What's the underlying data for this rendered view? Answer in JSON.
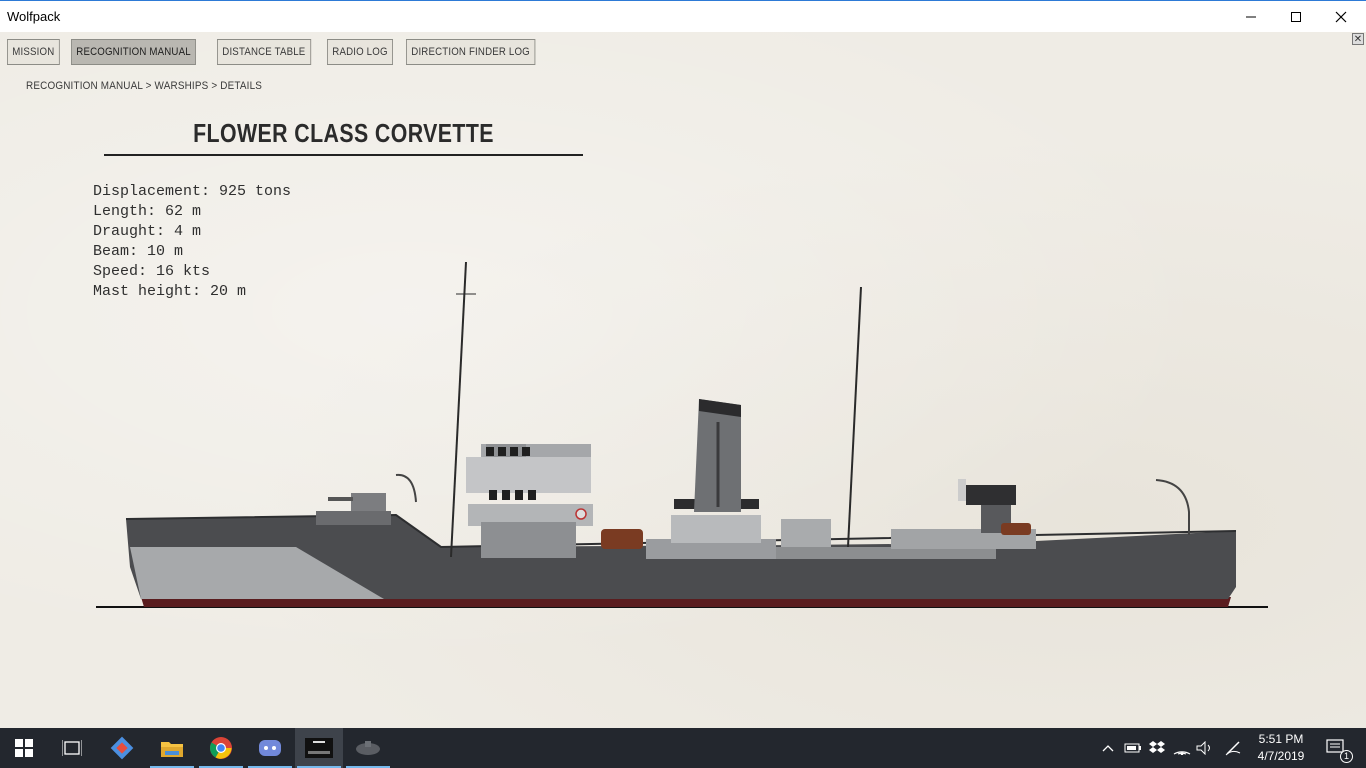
{
  "window": {
    "title": "Wolfpack"
  },
  "tabs": [
    {
      "label": "MISSION",
      "active": false
    },
    {
      "label": "RECOGNITION MANUAL",
      "active": true
    },
    {
      "label": "DISTANCE TABLE",
      "active": false
    },
    {
      "label": "RADIO LOG",
      "active": false
    },
    {
      "label": "DIRECTION FINDER LOG",
      "active": false
    }
  ],
  "breadcrumb": "RECOGNITION MANUAL > WARSHIPS > DETAILS",
  "ship": {
    "name": "FLOWER CLASS CORVETTE",
    "specs": [
      "Displacement: 925 tons",
      "Length: 62 m",
      "Draught: 4 m",
      "Beam: 10 m",
      "Speed: 16 kts",
      "Mast height: 20 m"
    ]
  },
  "taskbar": {
    "apps": [
      "windows-start-icon",
      "task-view-icon",
      "git-icon",
      "file-explorer-icon",
      "chrome-icon",
      "discord-icon",
      "wolfpack-app-icon",
      "submarine-app-icon"
    ],
    "time": "5:51 PM",
    "date": "4/7/2019",
    "notification_count": "1"
  },
  "colors": {
    "paper": "#efece5",
    "taskbar": "#23272e",
    "accent": "#76b9ed"
  }
}
